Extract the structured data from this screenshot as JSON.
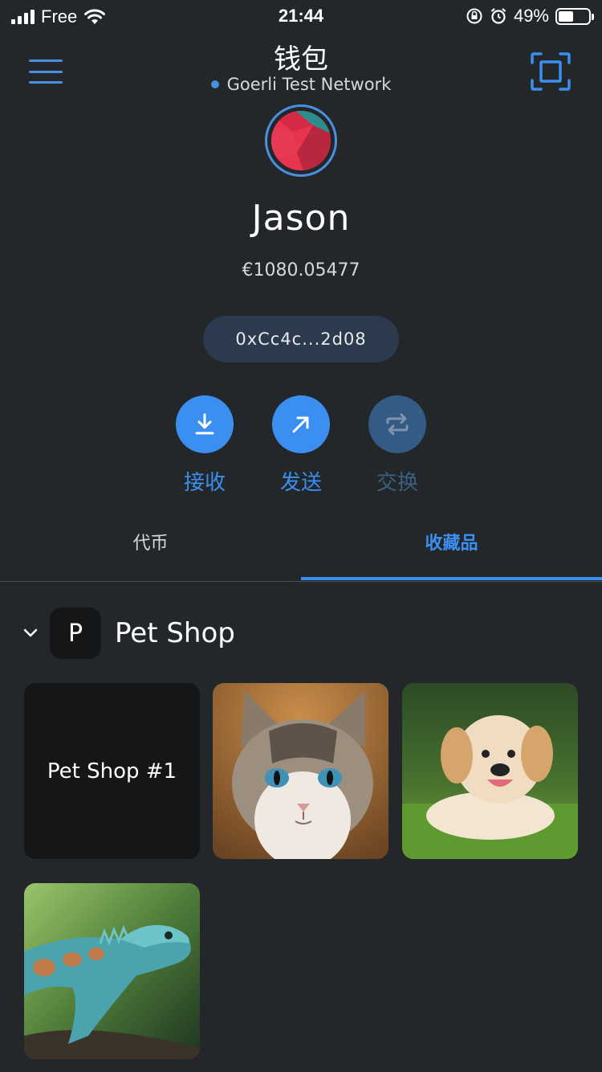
{
  "status_bar": {
    "carrier": "Free",
    "time": "21:44",
    "battery_percent": "49%",
    "battery_level": 0.49
  },
  "header": {
    "title": "钱包",
    "network": "Goerli Test Network",
    "network_dot_color": "#4a90e2"
  },
  "account": {
    "name": "Jason",
    "balance": "€1080.05477",
    "address": "0xCc4c...2d08"
  },
  "actions": [
    {
      "label": "接收",
      "icon": "download-icon",
      "enabled": true
    },
    {
      "label": "发送",
      "icon": "arrow-up-right-icon",
      "enabled": true
    },
    {
      "label": "交换",
      "icon": "swap-icon",
      "enabled": false
    }
  ],
  "tabs": [
    {
      "label": "代币",
      "active": false
    },
    {
      "label": "收藏品",
      "active": true
    }
  ],
  "collection": {
    "badge_letter": "P",
    "name": "Pet Shop",
    "items": [
      {
        "label": "Pet Shop #1",
        "kind": "text-placeholder"
      },
      {
        "label": "",
        "kind": "cat-image"
      },
      {
        "label": "",
        "kind": "dog-image"
      },
      {
        "label": "",
        "kind": "lizard-image"
      }
    ]
  },
  "colors": {
    "background": "#24272a",
    "accent": "#3b8ff0",
    "accent_disabled": "#345b84",
    "pill": "#2b3a4c"
  }
}
